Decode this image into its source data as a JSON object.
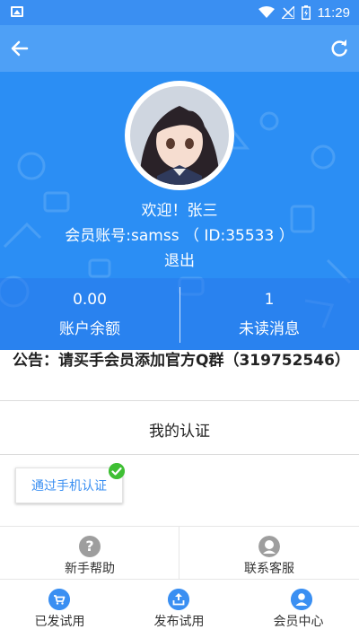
{
  "status_bar": {
    "time": "11:29",
    "icons": [
      "image-icon",
      "wifi-icon",
      "signal-icon",
      "battery-icon"
    ]
  },
  "app_bar": {
    "back_icon": "arrow-left-icon",
    "refresh_icon": "refresh-icon"
  },
  "profile": {
    "welcome": "欢迎！张三",
    "account": "会员账号:samss （ ID:35533 ）",
    "logout": "退出"
  },
  "stats": [
    {
      "value": "0.00",
      "label": "账户余额"
    },
    {
      "value": "1",
      "label": "未读消息"
    }
  ],
  "notice": "公告：请买手会员添加官方Q群（319752546）",
  "certification": {
    "title": "我的认证",
    "phone_verified_label": "通过手机认证"
  },
  "links": [
    {
      "label": "新手帮助",
      "icon": "question-icon"
    },
    {
      "label": "联系客服",
      "icon": "customer-service-icon"
    }
  ],
  "tab_bar": [
    {
      "label": "已发试用",
      "icon": "cart-icon"
    },
    {
      "label": "发布试用",
      "icon": "upload-icon"
    },
    {
      "label": "会员中心",
      "icon": "user-icon"
    }
  ],
  "colors": {
    "primary": "#2b8ef4",
    "app_bar": "#4ea0f6",
    "status_bar": "#3a8ff2",
    "verified": "#3fbf34",
    "grey_icon": "#9e9e9e"
  }
}
